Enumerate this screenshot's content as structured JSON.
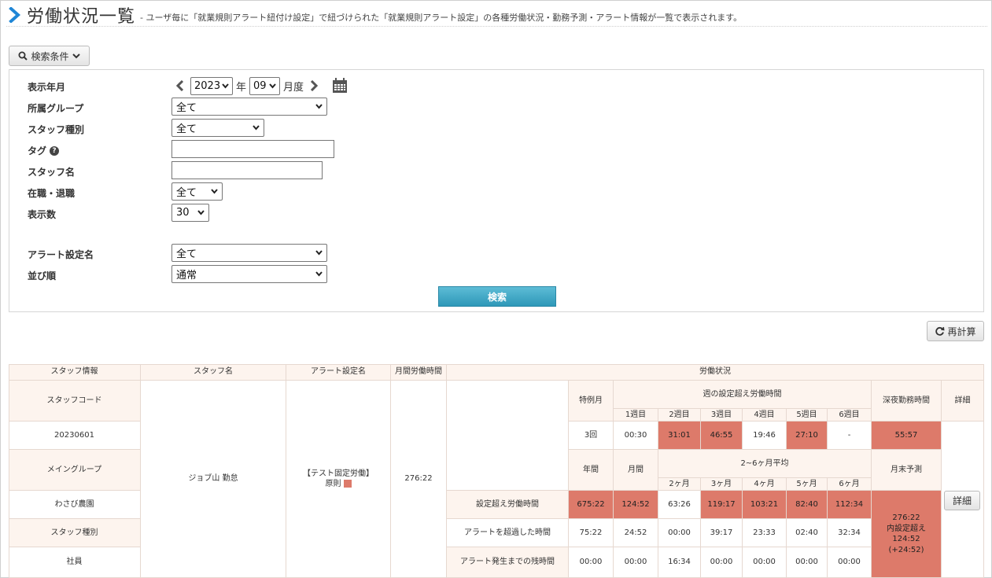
{
  "header": {
    "title": "労働状況一覧",
    "description": "- ユーザ毎に「就業規則アラート紐付け設定」で紐づけられた「就業規則アラート設定」の各種労働状況・勤務予測・アラート情報が一覧で表示されます。"
  },
  "search": {
    "toggle_label": "検索条件",
    "fields": {
      "display_month": {
        "label": "表示年月",
        "year": "2023",
        "year_unit": "年",
        "month": "09",
        "month_unit": "月度"
      },
      "group": {
        "label": "所属グループ",
        "value": "全て"
      },
      "staff_type": {
        "label": "スタッフ種別",
        "value": "全て"
      },
      "tag": {
        "label": "タグ",
        "value": ""
      },
      "staff_name": {
        "label": "スタッフ名",
        "value": ""
      },
      "employment": {
        "label": "在職・退職",
        "value": "全て"
      },
      "count": {
        "label": "表示数",
        "value": "30"
      },
      "alert_name": {
        "label": "アラート設定名",
        "value": "全て"
      },
      "sort": {
        "label": "並び順",
        "value": "通常"
      }
    },
    "search_button": "検索"
  },
  "recalc_button": "再計算",
  "table": {
    "headers": {
      "staff_info": "スタッフ情報",
      "staff_name": "スタッフ名",
      "alert_name": "アラート設定名",
      "monthly_hours": "月間労働時間",
      "status": "労働状況"
    },
    "left_rows": {
      "staff_code_label": "スタッフコード",
      "staff_code": "20230601",
      "main_group_label": "メイングループ",
      "main_group": "わさび農園",
      "staff_type_label": "スタッフ種別",
      "staff_type": "社員"
    },
    "staff_name": "ジョブ山 勤怠",
    "alert_setting": "【テスト固定労働】",
    "alert_setting_sub": "原則",
    "monthly_hours": "276:22",
    "status": {
      "special_month_label": "特例月",
      "weekly_over_label": "週の設定超え労働時間",
      "weeks": [
        "1週目",
        "2週目",
        "3週目",
        "4週目",
        "5週目",
        "6週目"
      ],
      "night_label": "深夜勤務時間",
      "detail_label": "詳細",
      "special_month_value": "3回",
      "week_values": [
        "00:30",
        "31:01",
        "46:55",
        "19:46",
        "27:10",
        "-"
      ],
      "night_value": "55:57",
      "annual_label": "年間",
      "monthly_label": "月間",
      "avg_label": "2~6ヶ月平均",
      "avg_months": [
        "2ヶ月",
        "3ヶ月",
        "4ヶ月",
        "5ヶ月",
        "6ヶ月"
      ],
      "month_end_label": "月末予測",
      "rows": [
        {
          "label": "設定超え労働時間",
          "values": [
            "675:22",
            "124:52",
            "63:26",
            "119:17",
            "103:21",
            "82:40",
            "112:34"
          ]
        },
        {
          "label": "アラートを超過した時間",
          "values": [
            "75:22",
            "24:52",
            "00:00",
            "39:17",
            "23:33",
            "02:40",
            "32:34"
          ]
        },
        {
          "label": "アラート発生までの残時間",
          "values": [
            "00:00",
            "00:00",
            "16:34",
            "00:00",
            "00:00",
            "00:00",
            "00:00"
          ]
        }
      ],
      "forecast": [
        "276:22",
        "内設定超え",
        "124:52",
        "(+24:52)"
      ],
      "detail_button": "詳細"
    }
  },
  "colors": {
    "alert": "#dd7a6a",
    "header_bg": "#fdf4ee",
    "accent": "#2e98b8"
  }
}
